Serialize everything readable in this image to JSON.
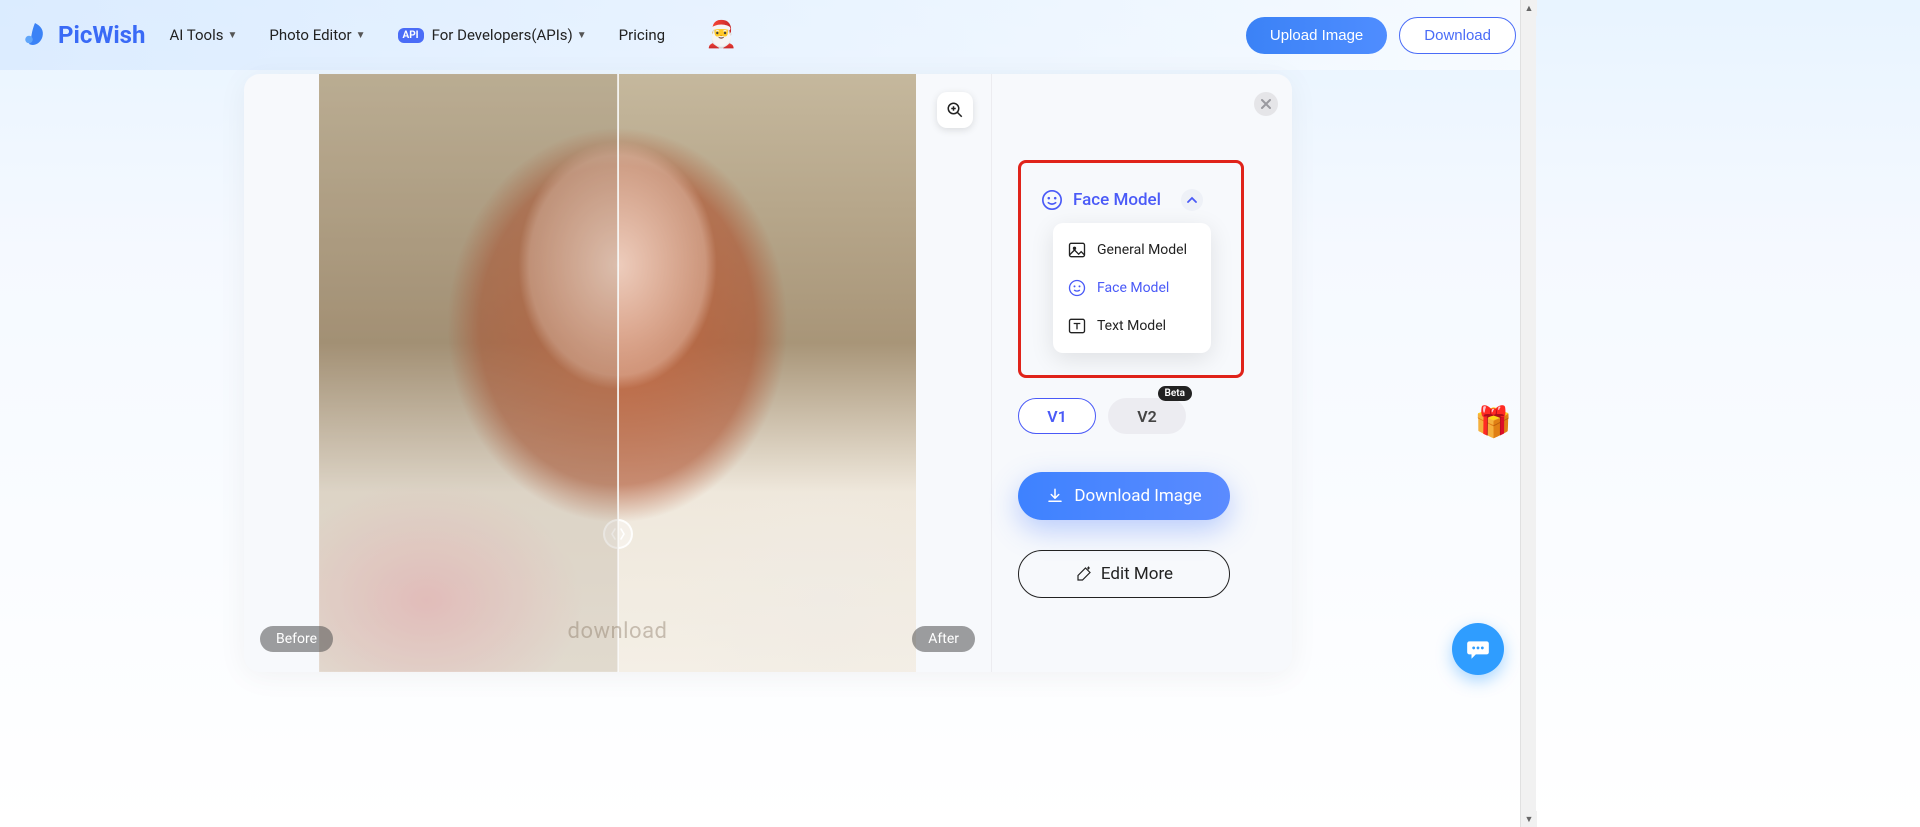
{
  "brand": {
    "name": "PicWish"
  },
  "nav": {
    "ai_tools": "AI Tools",
    "photo_editor": "Photo Editor",
    "api_badge": "API",
    "for_developers": "For Developers(APIs)",
    "pricing": "Pricing"
  },
  "header": {
    "upload": "Upload Image",
    "download": "Download"
  },
  "compare": {
    "before": "Before",
    "after": "After",
    "watermark": "download"
  },
  "panel": {
    "selected_model": "Face Model",
    "models": {
      "general": "General Model",
      "face": "Face Model",
      "text": "Text Model"
    },
    "versions": {
      "v1": "V1",
      "v2": "V2",
      "beta": "Beta"
    },
    "download_image": "Download Image",
    "edit_more": "Edit More"
  }
}
